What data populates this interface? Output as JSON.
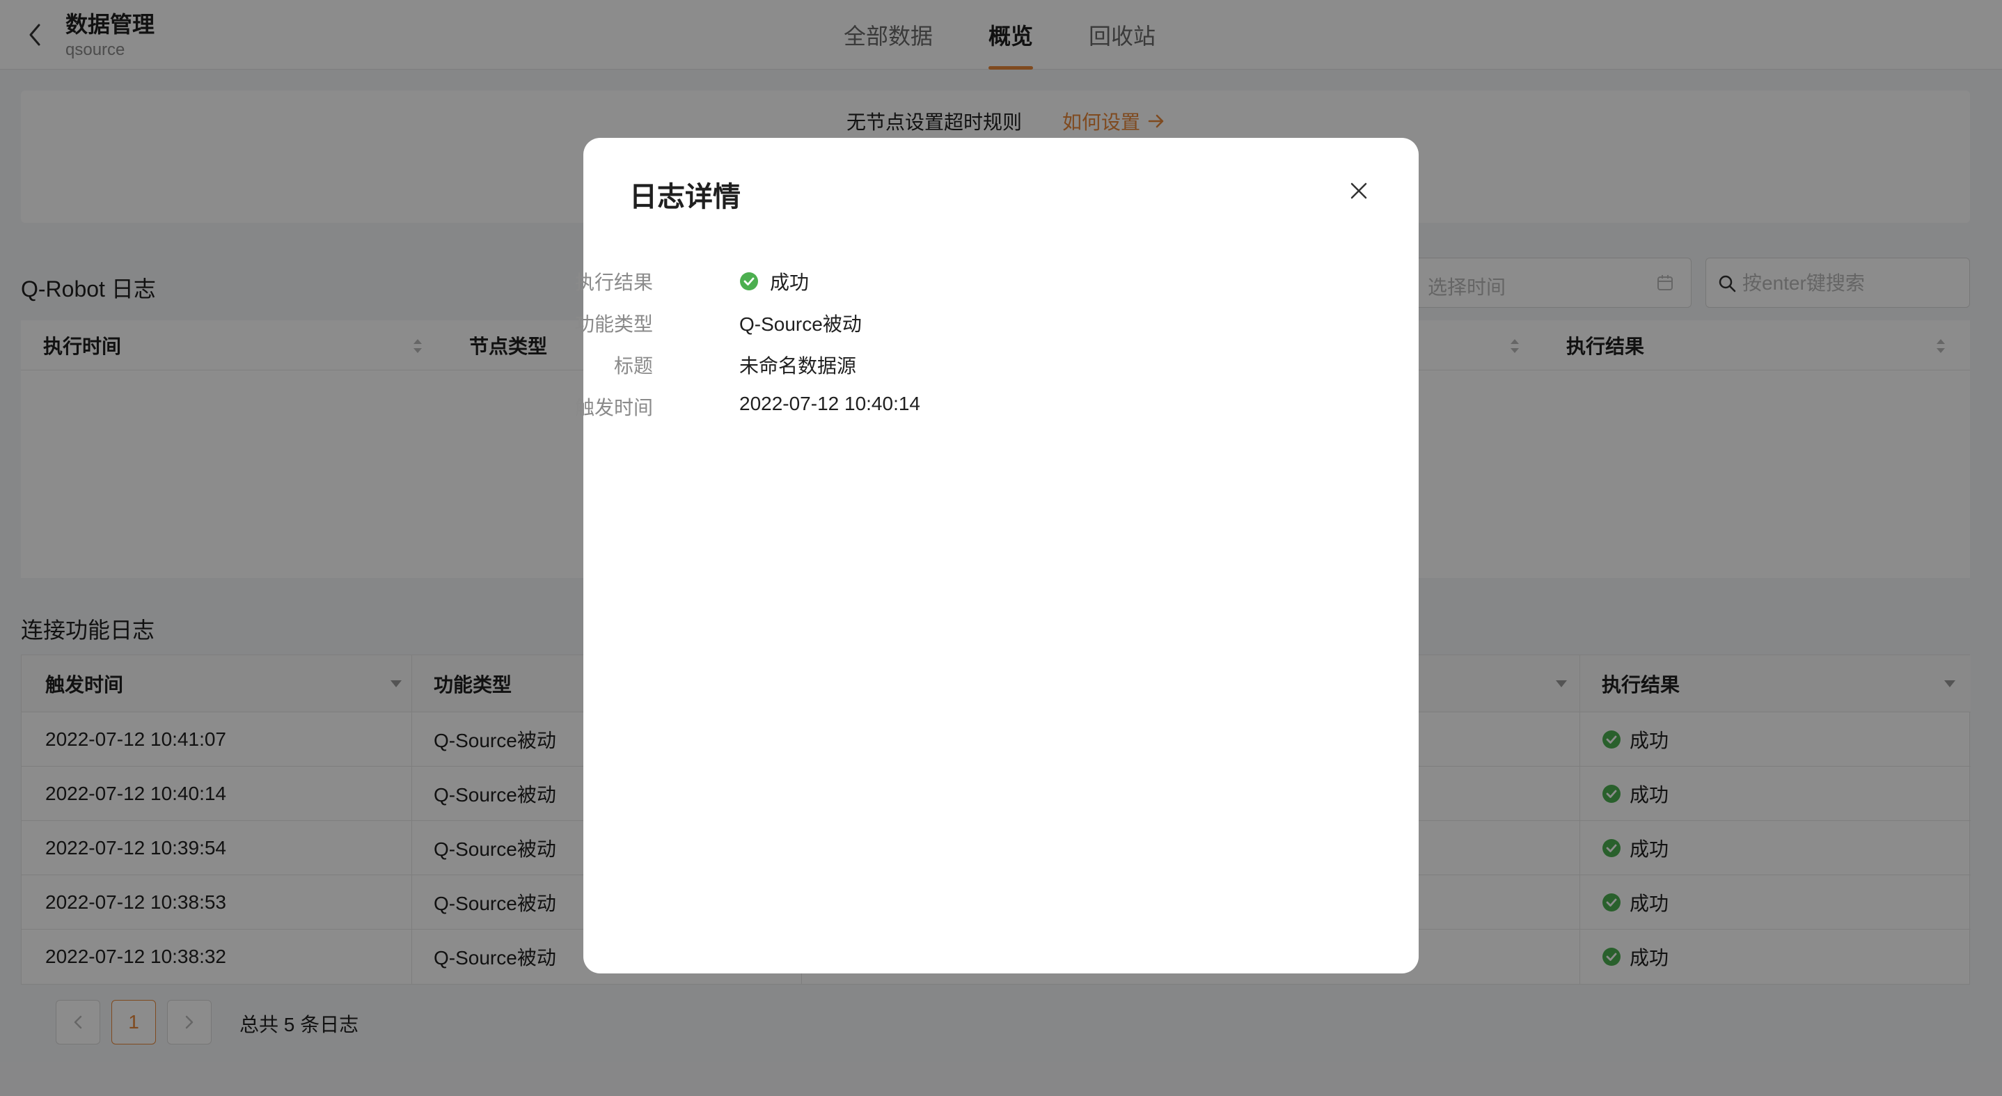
{
  "header": {
    "title": "数据管理",
    "subtitle": "qsource",
    "tabs": [
      {
        "label": "全部数据",
        "active": false
      },
      {
        "label": "概览",
        "active": true
      },
      {
        "label": "回收站",
        "active": false
      }
    ]
  },
  "banner": {
    "text": "无节点设置超时规则",
    "link_label": "如何设置"
  },
  "robot_log": {
    "title": "Q-Robot 日志",
    "time_placeholder": "选择时间",
    "search_placeholder": "按enter键搜索",
    "columns": [
      "执行时间",
      "节点类型",
      "执行结果"
    ]
  },
  "connect_log": {
    "title": "连接功能日志",
    "columns": [
      "触发时间",
      "功能类型",
      "执行结果"
    ],
    "rows": [
      {
        "time": "2022-07-12 10:41:07",
        "type": "Q-Source被动",
        "result": "成功"
      },
      {
        "time": "2022-07-12 10:40:14",
        "type": "Q-Source被动",
        "result": "成功"
      },
      {
        "time": "2022-07-12 10:39:54",
        "type": "Q-Source被动",
        "result": "成功"
      },
      {
        "time": "2022-07-12 10:38:53",
        "type": "Q-Source被动",
        "result": "成功"
      },
      {
        "time": "2022-07-12 10:38:32",
        "type": "Q-Source被动",
        "result": "成功"
      }
    ]
  },
  "pagination": {
    "current_page": "1",
    "total_text": "总共 5 条日志"
  },
  "modal": {
    "title": "日志详情",
    "fields": [
      {
        "label": "执行结果",
        "value": "成功"
      },
      {
        "label": "功能类型",
        "value": "Q-Source被动"
      },
      {
        "label": "标题",
        "value": "未命名数据源"
      },
      {
        "label": "触发时间",
        "value": "2022-07-12 10:40:14"
      }
    ]
  },
  "colors": {
    "accent": "#e8873a",
    "success": "#4caf50",
    "overlay": "rgba(0,0,0,0.45)"
  }
}
